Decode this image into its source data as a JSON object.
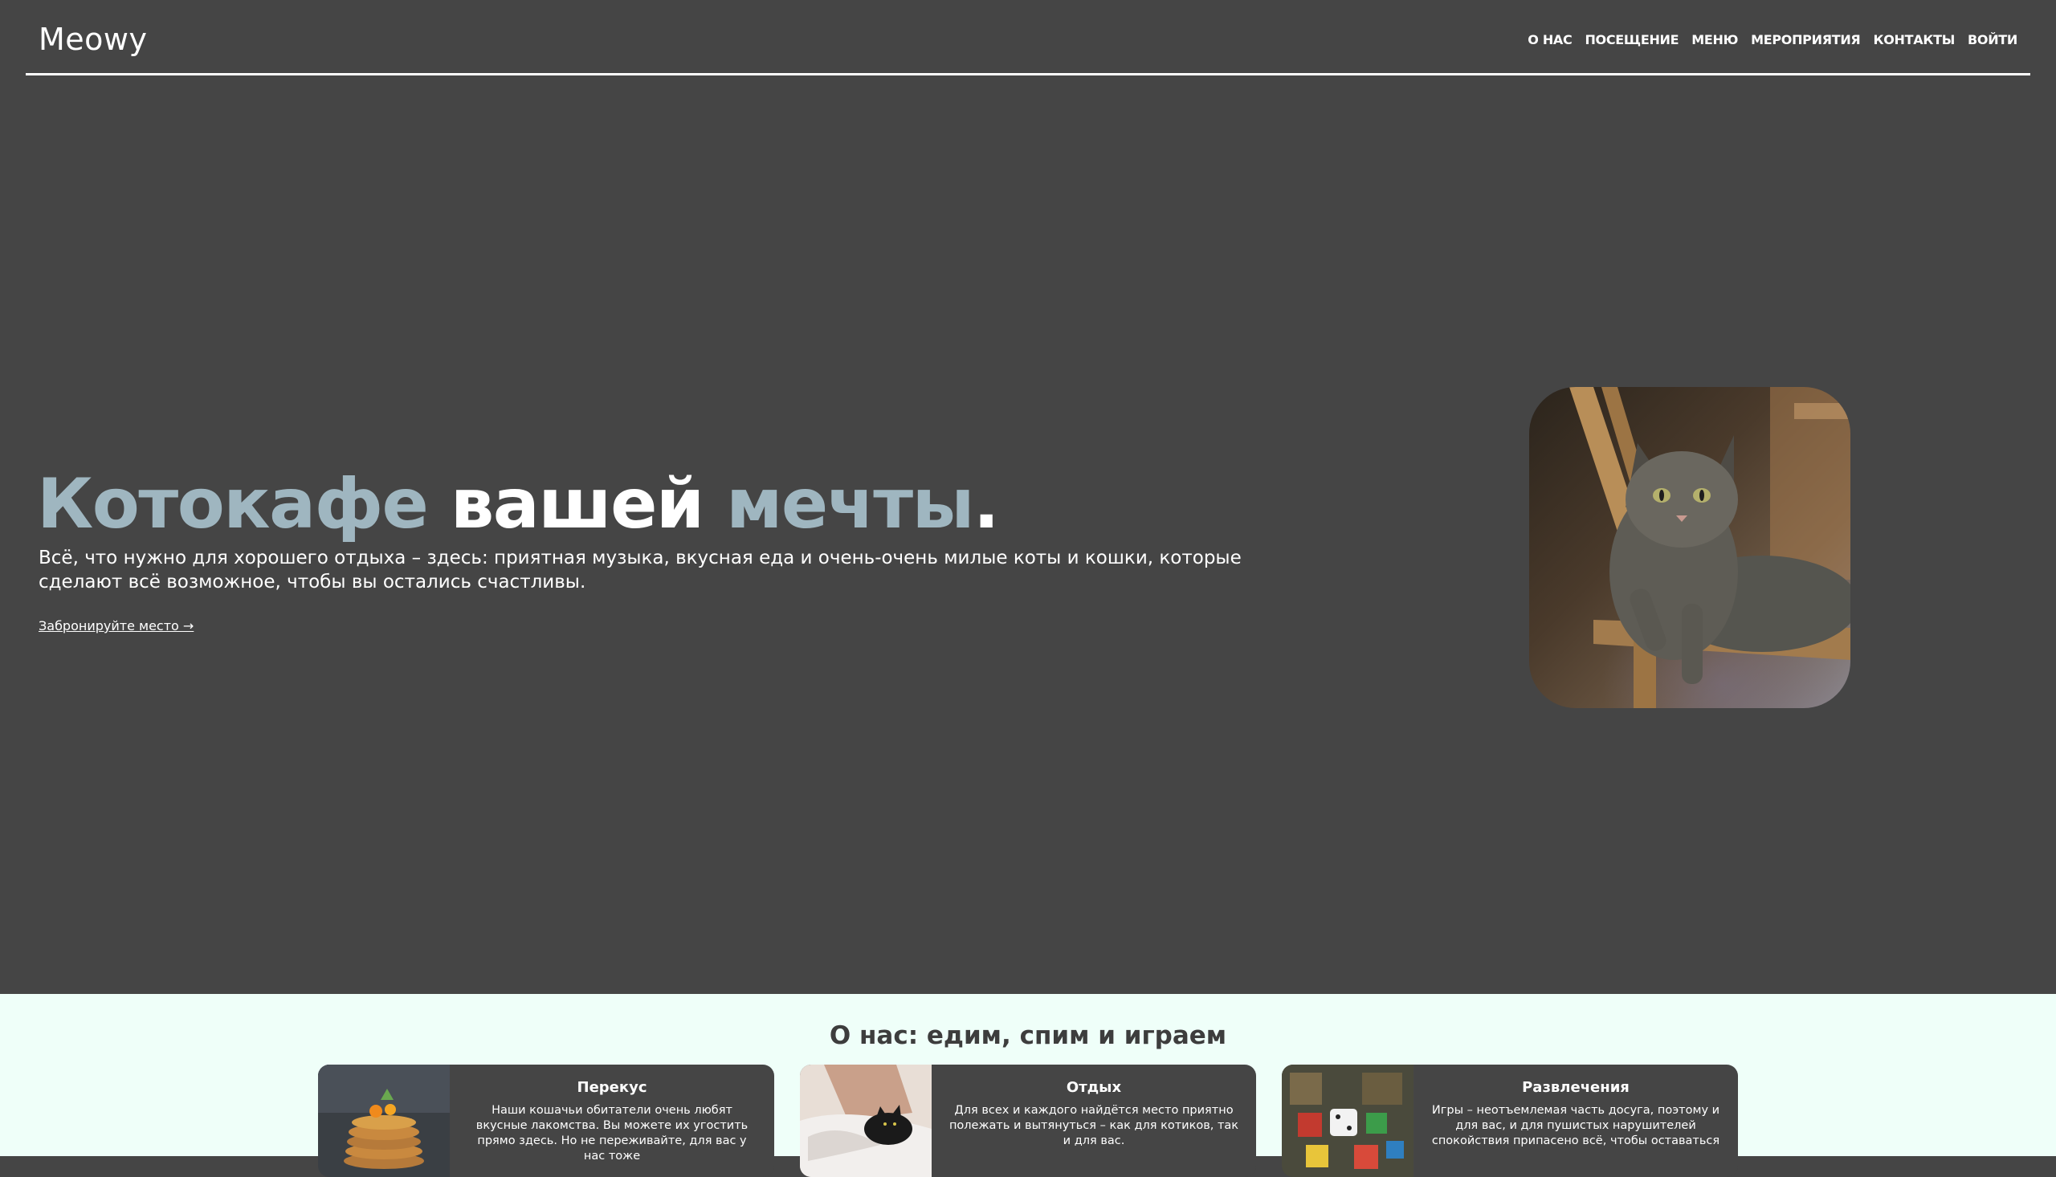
{
  "header": {
    "logo": "Meowy",
    "nav": [
      "О НАС",
      "ПОСЕЩЕНИЕ",
      "МЕНЮ",
      "МЕРОПРИЯТИЯ",
      "КОНТАКТЫ",
      "ВОЙТИ"
    ]
  },
  "hero": {
    "title_part1": "Котокафе ",
    "title_part2": "вашей ",
    "title_part3": "мечты",
    "title_dot": ".",
    "subtitle": "Всё, что нужно для хорошего отдыха – здесь: приятная музыка, вкусная еда и очень-очень милые коты и кошки, которые сделают всё возможное, чтобы вы остались счастливы.",
    "cta": "Забронируйте место →",
    "photo_icon": "cat-photo"
  },
  "about": {
    "title": "О нас: едим, спим и играем",
    "cards": [
      {
        "title": "Перекус",
        "text": "Наши кошачьи обитатели очень любят вкусные лакомства. Вы можете их угостить прямо здесь. Но не переживайте, для вас у нас тоже",
        "icon": "pancakes-photo"
      },
      {
        "title": "Отдых",
        "text": "Для всех и каждого найдётся место приятно полежать и вытянуться – как для котиков, так и для вас.",
        "icon": "sleeping-cat-photo"
      },
      {
        "title": "Развлечения",
        "text": "Игры – неотъемлемая часть досуга, поэтому и для вас, и для пушистых нарушителей спокойствия припасено всё, чтобы оставаться",
        "icon": "board-games-photo"
      }
    ]
  },
  "colors": {
    "background": "#454545",
    "accent": "#9fb6c0",
    "about_background": "#effff9"
  }
}
